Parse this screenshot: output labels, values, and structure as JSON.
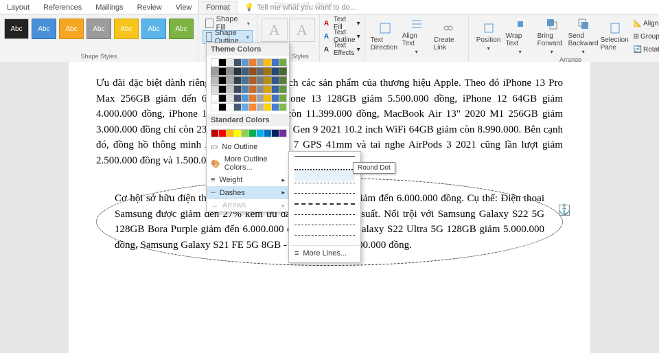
{
  "window": {
    "title": "Document2 - Word"
  },
  "tabs": {
    "layout": "Layout",
    "references": "References",
    "mailings": "Mailings",
    "review": "Review",
    "view": "View",
    "format": "Format",
    "tell": "Tell me what you want to do..."
  },
  "ribbon": {
    "shape_styles_label": "Shape Styles",
    "style_text": "Abc",
    "shape_fill": "Shape Fill",
    "shape_outline": "Shape Outline",
    "wordart_styles_label": "WordArt Styles",
    "wa_a": "A",
    "text_fill": "Text Fill",
    "text_outline": "Text Outline",
    "text_effects": "Text Effects",
    "text_direction": "Text Direction",
    "align_text": "Align Text",
    "create_link": "Create Link",
    "position": "Position",
    "wrap_text": "Wrap Text",
    "bring_forward": "Bring Forward",
    "send_backward": "Send Backward",
    "selection_pane": "Selection Pane",
    "align": "Align",
    "group": "Group",
    "rotate": "Rotate",
    "arrange_label": "Arrange"
  },
  "outline_popup": {
    "theme_colors": "Theme Colors",
    "standard_colors": "Standard Colors",
    "no_outline": "No Outline",
    "more_colors": "More Outline Colors...",
    "weight": "Weight",
    "dashes": "Dashes",
    "arrows": "Arrows",
    "theme_row": [
      "#ffffff",
      "#000000",
      "#e7e6e6",
      "#44546a",
      "#5b9bd5",
      "#ed7d31",
      "#a5a5a5",
      "#ffc000",
      "#4472c4",
      "#70ad47"
    ],
    "std_row": [
      "#c00000",
      "#ff0000",
      "#ffc000",
      "#ffff00",
      "#92d050",
      "#00b050",
      "#00b0f0",
      "#0070c0",
      "#002060",
      "#7030a0"
    ]
  },
  "dash_flyout": {
    "tooltip": "Round Dot",
    "more_lines": "More Lines..."
  },
  "document": {
    "para1": "Ưu đãi đặc biệt dành riêng cho người yêu thích các sản phẩm của thương hiệu Apple. Theo đó iPhone 13 Pro Max 256GB giảm đến 6.500.000 đồng, iPhone 13 128GB giảm 5.500.000 đồng, iPhone 12 64GB giảm 4.000.000 đồng, iPhone 11 64GB giảm chỉ còn 11.399.000 đồng, MacBook Air 13\" 2020 M1 256GB giảm 3.000.000 đồng chỉ còn 23.999.000 đồng, iPad Gen 9 2021 10.2 inch WiFi 64GB giảm còn 8.990.000. Bên cạnh đó, đồng hồ thông minh Apple Watch Series 7 GPS 41mm và tai nghe AirPods 3 2021 cũng lần lượt giảm 2.500.000 đồng và 1.500.000 đồng.",
    "para2": "Cơ hội sở hữu điện thoại chính hãng với giá siêu ưu đãi, giảm đến 6.000.000 đồng. Cụ thể: Điện thoại Samsung được giảm đến 27% kèm ưu đãi trả góp 0% lãi suất. Nổi trội với Samsung Galaxy S22 5G 128GB Bora Purple giảm đến 6.000.000 đồng, Samsung Galaxy S22 Ultra 5G 128GB giảm 5.000.000 đồng, Samsung Galaxy S21 FE 5G 8GB - 128GB giảm 4.000.000 đồng."
  }
}
